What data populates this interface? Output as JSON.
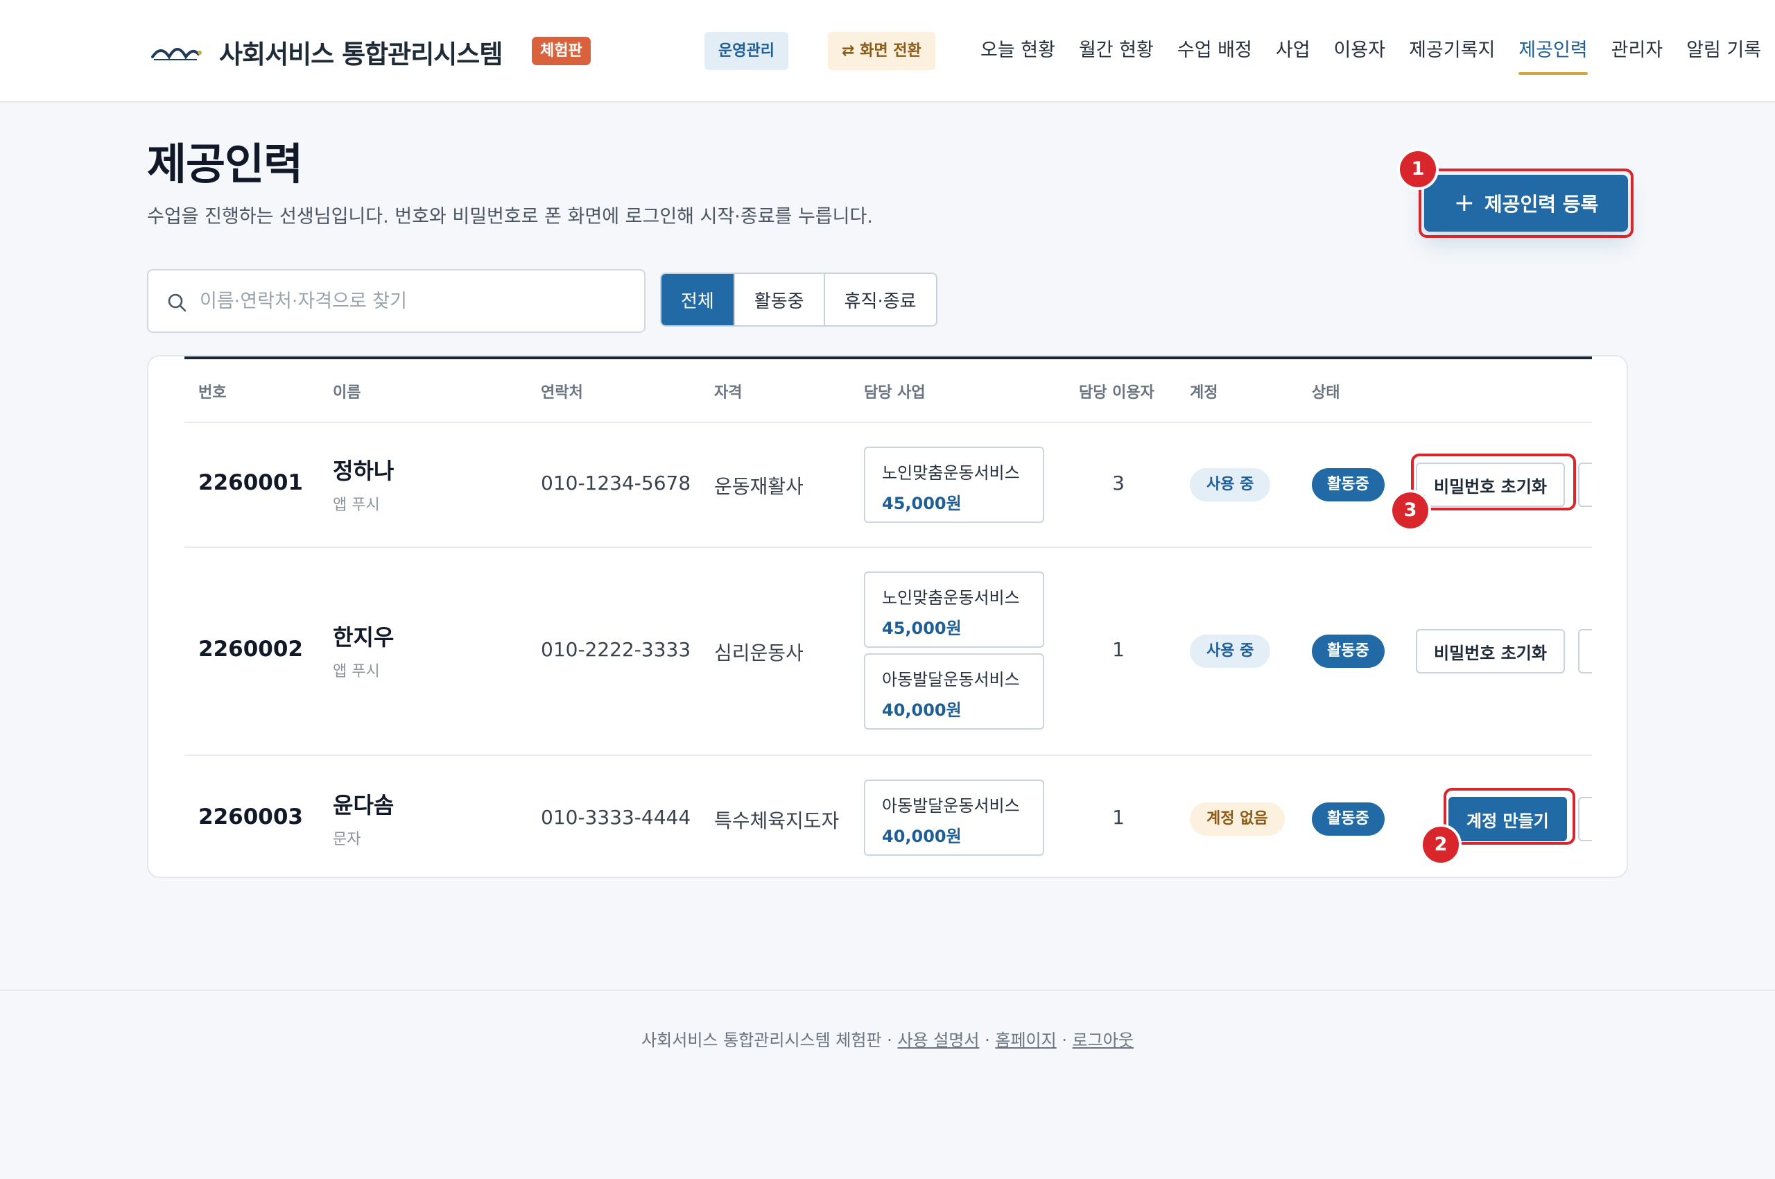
{
  "header": {
    "brand": "사회서비스 통합관리시스템",
    "badge": "체험판",
    "mode": "운영관리",
    "switch_label": "⇄ 화면 전환",
    "nav": [
      {
        "label": "오늘 현황"
      },
      {
        "label": "월간 현황"
      },
      {
        "label": "수업 배정"
      },
      {
        "label": "사업"
      },
      {
        "label": "이용자"
      },
      {
        "label": "제공기록지"
      },
      {
        "label": "제공인력",
        "active": true
      },
      {
        "label": "관리자"
      },
      {
        "label": "알림 기록"
      }
    ]
  },
  "page": {
    "title": "제공인력",
    "description": "수업을 진행하는 선생님입니다. 번호와 비밀번호로 폰 화면에 로그인해 시작·종료를 누릅니다.",
    "register_label": "제공인력 등록"
  },
  "search": {
    "placeholder": "이름·연락처·자격으로 찾기",
    "value": ""
  },
  "filters": [
    {
      "label": "전체",
      "active": true
    },
    {
      "label": "활동중"
    },
    {
      "label": "휴직·종료"
    }
  ],
  "table": {
    "columns": [
      "번호",
      "이름",
      "연락처",
      "자격",
      "담당 사업",
      "담당 이용자",
      "계정",
      "상태"
    ],
    "rows": [
      {
        "id": "2260001",
        "name": "정하나",
        "notify": "앱 푸시",
        "phone": "010-1234-5678",
        "qual": "운동재활사",
        "programs": [
          {
            "name": "노인맞춤운동서비스",
            "price": "45,000원"
          }
        ],
        "clients": "3",
        "account": "사용 중",
        "status": "활동중",
        "action": "비밀번호 초기화"
      },
      {
        "id": "2260002",
        "name": "한지우",
        "notify": "앱 푸시",
        "phone": "010-2222-3333",
        "qual": "심리운동사",
        "programs": [
          {
            "name": "노인맞춤운동서비스",
            "price": "45,000원"
          },
          {
            "name": "아동발달운동서비스",
            "price": "40,000원"
          }
        ],
        "clients": "1",
        "account": "사용 중",
        "status": "활동중",
        "action": "비밀번호 초기화"
      },
      {
        "id": "2260003",
        "name": "윤다솜",
        "notify": "문자",
        "phone": "010-3333-4444",
        "qual": "특수체육지도자",
        "programs": [
          {
            "name": "아동발달운동서비스",
            "price": "40,000원"
          }
        ],
        "clients": "1",
        "account": "계정 없음",
        "status": "활동중",
        "action": "계정 만들기"
      }
    ]
  },
  "callouts": [
    "1",
    "2",
    "3"
  ],
  "footer": {
    "text": "사회서비스 통합관리시스템 체험판 · ",
    "links": [
      "사용 설명서",
      "홈페이지",
      "로그아웃"
    ],
    "sep": " · "
  },
  "colors": {
    "primary": "#216aa6",
    "accent": "#d3a73e",
    "badge": "#d9623c",
    "callout": "#d8262c"
  }
}
